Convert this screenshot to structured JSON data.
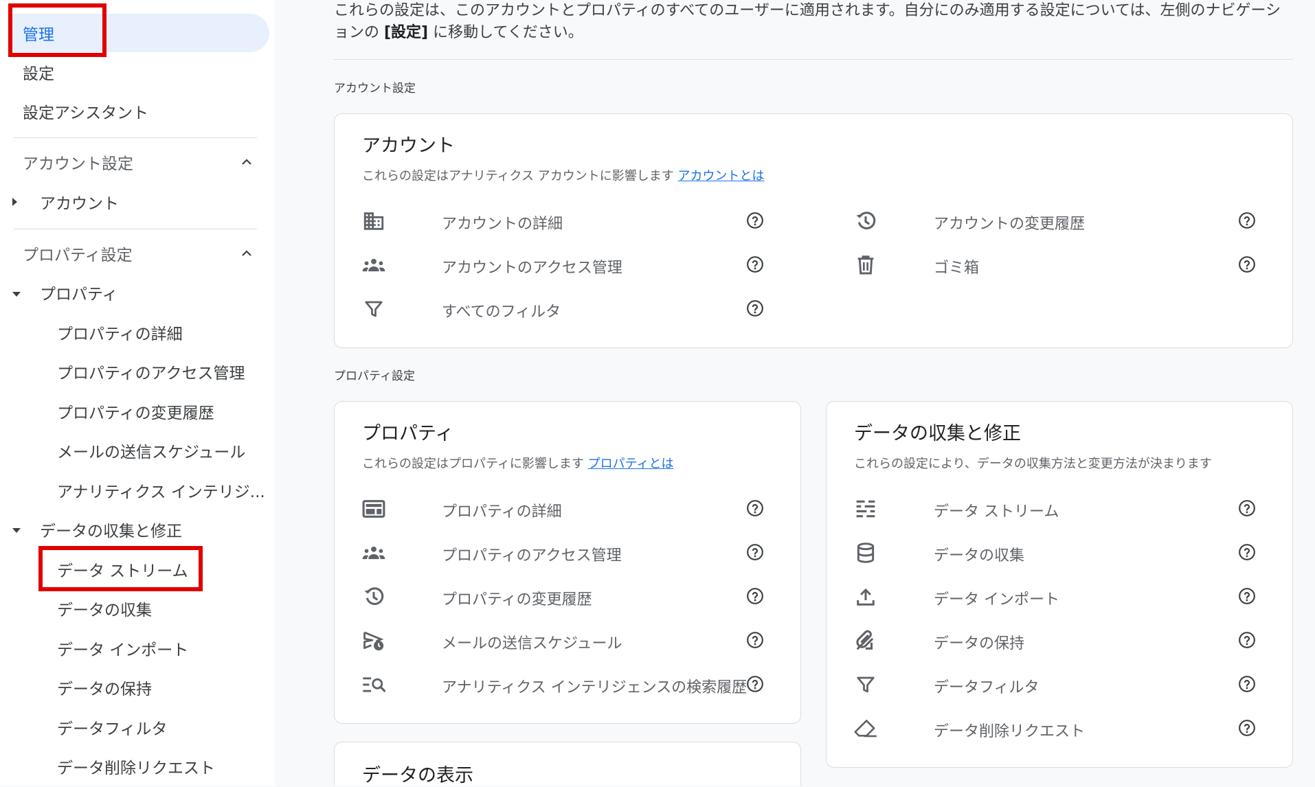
{
  "sidebar": {
    "admin": "管理",
    "settings": "設定",
    "setup_assistant": "設定アシスタント",
    "account_section": "アカウント設定",
    "account": "アカウント",
    "property_section": "プロパティ設定",
    "property": "プロパティ",
    "property_items": [
      "プロパティの詳細",
      "プロパティのアクセス管理",
      "プロパティの変更履歴",
      "メールの送信スケジュール",
      "アナリティクス インテリジ..."
    ],
    "data_section": "データの収集と修正",
    "data_items": [
      "データ ストリーム",
      "データの収集",
      "データ インポート",
      "データの保持",
      "データフィルタ",
      "データ削除リクエスト"
    ]
  },
  "main": {
    "intro_part1": "これらの設定は、このアカウントとプロパティのすべてのユーザーに適用されます。自分にのみ適用する設定については、左側のナビゲーションの ",
    "intro_bold": "[設定]",
    "intro_part2": " に移動してください。",
    "account_group_label": "アカウント設定",
    "property_group_label": "プロパティ設定",
    "account_card": {
      "title": "アカウント",
      "desc": "これらの設定はアナリティクス アカウントに影響します ",
      "link": "アカウントとは",
      "left_items": [
        {
          "label": "アカウントの詳細",
          "icon": "building-icon"
        },
        {
          "label": "アカウントのアクセス管理",
          "icon": "people-icon"
        },
        {
          "label": "すべてのフィルタ",
          "icon": "filter-icon"
        }
      ],
      "right_items": [
        {
          "label": "アカウントの変更履歴",
          "icon": "history-icon"
        },
        {
          "label": "ゴミ箱",
          "icon": "trash-icon"
        }
      ]
    },
    "property_card": {
      "title": "プロパティ",
      "desc": "これらの設定はプロパティに影響します ",
      "link": "プロパティとは",
      "items": [
        {
          "label": "プロパティの詳細",
          "icon": "web-layout-icon"
        },
        {
          "label": "プロパティのアクセス管理",
          "icon": "people-icon"
        },
        {
          "label": "プロパティの変更履歴",
          "icon": "history-icon"
        },
        {
          "label": "メールの送信スケジュール",
          "icon": "scheduled-send-icon"
        },
        {
          "label": "アナリティクス インテリジェンスの検索履歴",
          "icon": "search-list-icon"
        }
      ]
    },
    "data_card": {
      "title": "データの収集と修正",
      "desc": "これらの設定により、データの収集方法と変更方法が決まります",
      "items": [
        {
          "label": "データ ストリーム",
          "icon": "streams-icon"
        },
        {
          "label": "データの収集",
          "icon": "database-icon"
        },
        {
          "label": "データ インポート",
          "icon": "upload-icon"
        },
        {
          "label": "データの保持",
          "icon": "retention-icon"
        },
        {
          "label": "データフィルタ",
          "icon": "filter-icon"
        },
        {
          "label": "データ削除リクエスト",
          "icon": "eraser-icon"
        }
      ]
    },
    "display_card": {
      "title": "データの表示"
    }
  },
  "colors": {
    "accent": "#1a73e8",
    "highlight": "#e00000",
    "selected_bg": "#e8f0fe",
    "icon": "#5f6368"
  }
}
